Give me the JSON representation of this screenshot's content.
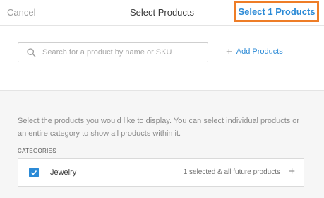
{
  "header": {
    "cancel_label": "Cancel",
    "title": "Select Products",
    "select_button_label": "Select 1 Products"
  },
  "search": {
    "placeholder": "Search for a product by name or SKU",
    "value": ""
  },
  "add_products_label": "Add Products",
  "description": "Select the products you would like to display. You can select individual products or an entire category to show all products within it.",
  "categories": {
    "label": "CATEGORIES",
    "items": [
      {
        "name": "Jewelry",
        "checked": true,
        "status": "1 selected & all future products"
      }
    ]
  },
  "colors": {
    "accent": "#2b8ad6",
    "highlight_border": "#ee7d27"
  },
  "icons": {
    "search": "search-icon",
    "add": "plus-icon",
    "check": "checkmark-icon",
    "expand": "plus-icon"
  }
}
